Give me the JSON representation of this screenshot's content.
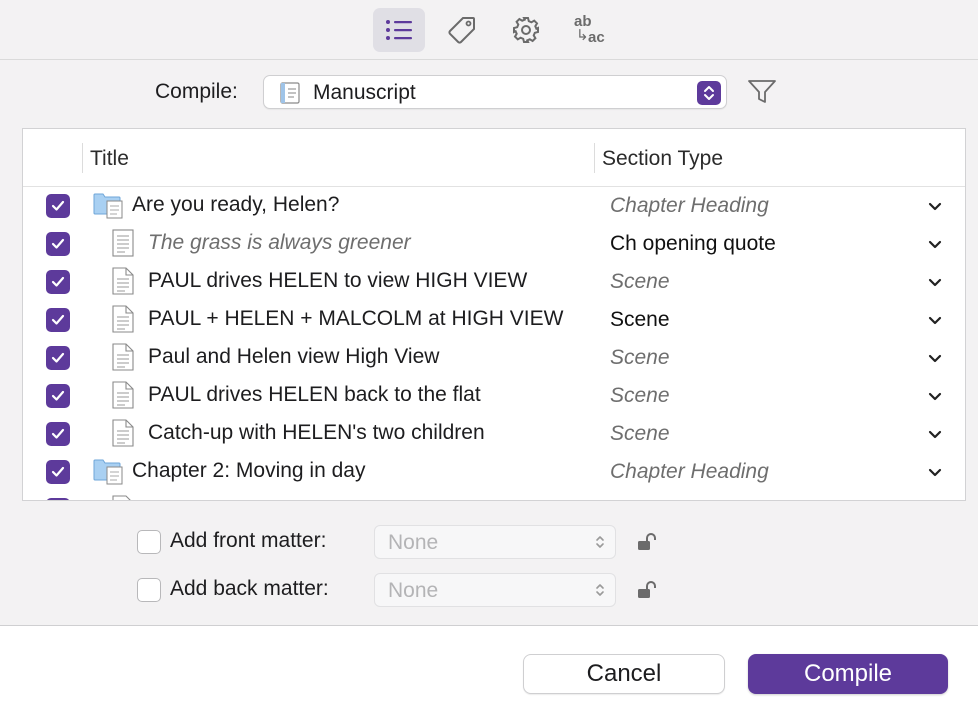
{
  "toolbar": {
    "icons": [
      "list-icon",
      "tag-icon",
      "gear-icon",
      "replace-text-icon"
    ],
    "replace_top": "ab",
    "replace_arrow": "↳",
    "replace_bottom": "ac"
  },
  "compile": {
    "label": "Compile:",
    "value": "Manuscript"
  },
  "table": {
    "headers": {
      "title": "Title",
      "section_type": "Section Type"
    },
    "rows": [
      {
        "title": "Are you ready, Helen?",
        "section_type": "Chapter Heading",
        "kind": "folder",
        "checked": true
      },
      {
        "title": "The grass is always greener",
        "section_type": "Ch opening quote",
        "kind": "text",
        "checked": true
      },
      {
        "title": "PAUL drives HELEN to view HIGH VIEW",
        "section_type": "Scene",
        "kind": "doc",
        "checked": true
      },
      {
        "title": "PAUL + HELEN + MALCOLM at HIGH VIEW",
        "section_type": "Scene",
        "kind": "doc",
        "checked": true
      },
      {
        "title": "Paul and Helen view High View",
        "section_type": "Scene",
        "kind": "doc",
        "checked": true
      },
      {
        "title": "PAUL drives HELEN back to the flat",
        "section_type": "Scene",
        "kind": "doc",
        "checked": true
      },
      {
        "title": "Catch-up with HELEN's two children",
        "section_type": "Scene",
        "kind": "doc",
        "checked": true
      },
      {
        "title": "Chapter 2: Moving in day",
        "section_type": "Chapter Heading",
        "kind": "folder",
        "checked": true
      }
    ]
  },
  "front_matter": {
    "label": "Add front matter:",
    "value": "None",
    "checked": false
  },
  "back_matter": {
    "label": "Add back matter:",
    "value": "None",
    "checked": false
  },
  "buttons": {
    "cancel": "Cancel",
    "compile": "Compile"
  },
  "colors": {
    "accent": "#5d3a9b",
    "panel": "#f3f2f3"
  }
}
